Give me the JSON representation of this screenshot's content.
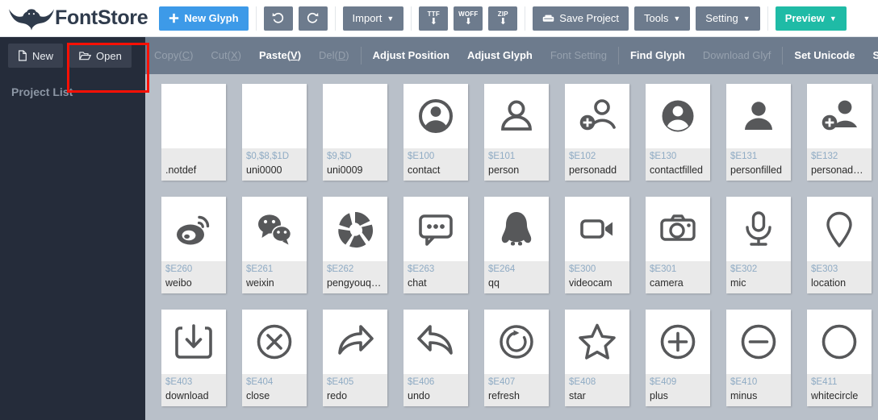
{
  "header": {
    "brand": "FontStore",
    "logo_icon": "bat-logo-icon",
    "new_glyph_label": "New Glyph",
    "new_glyph_icon": "plus-icon",
    "undo_icon": "undo-arrow-icon",
    "redo_icon": "redo-arrow-icon",
    "import_label": "Import",
    "ttf_label": "TTF",
    "woff_label": "WOFF",
    "zip_label": "ZIP",
    "download_arrow_icon": "download-arrow-icon",
    "save_project_label": "Save Project",
    "save_icon": "save-disk-icon",
    "tools_label": "Tools",
    "setting_label": "Setting",
    "preview_label": "Preview",
    "caret": "⌄",
    "accent_blue": "#3d9ae8",
    "accent_teal": "#1fbba6",
    "btn_grey": "#6d7b8d"
  },
  "menubar": {
    "new_label": "New",
    "new_icon": "file-icon",
    "open_label": "Open",
    "open_icon": "folder-open-icon",
    "items": [
      {
        "label": "Copy(C)",
        "text": "Copy(",
        "key": "C",
        "tail": ")",
        "enabled": false
      },
      {
        "label": "Cut(X)",
        "text": "Cut(",
        "key": "X",
        "tail": ")",
        "enabled": false
      },
      {
        "label": "Paste(V)",
        "text": "Paste(",
        "key": "V",
        "tail": ")",
        "enabled": true
      },
      {
        "label": "Del(D)",
        "text": "Del(",
        "key": "D",
        "tail": ")",
        "enabled": false
      }
    ],
    "items2": [
      {
        "label": "Adjust Position",
        "enabled": true
      },
      {
        "label": "Adjust Glyph",
        "enabled": true
      },
      {
        "label": "Font Setting",
        "enabled": false
      },
      {
        "label": "Find Glyph",
        "enabled": true
      },
      {
        "label": "Download Glyf",
        "enabled": false
      },
      {
        "label": "Set Unicode",
        "enabled": true
      },
      {
        "label": "Sync Font",
        "enabled": true
      }
    ]
  },
  "sidebar": {
    "title": "Project List"
  },
  "annotation": {
    "color": "#fc1005",
    "targets": "open-button"
  },
  "glyphs": [
    {
      "code": "",
      "name": ".notdef",
      "icon": "none"
    },
    {
      "code": "$0,$8,$1D",
      "name": "uni0000",
      "icon": "none"
    },
    {
      "code": "$9,$D",
      "name": "uni0009",
      "icon": "none"
    },
    {
      "code": "$E100",
      "name": "contact",
      "icon": "contact-outline-icon"
    },
    {
      "code": "$E101",
      "name": "person",
      "icon": "person-outline-icon"
    },
    {
      "code": "$E102",
      "name": "personadd",
      "icon": "person-add-icon"
    },
    {
      "code": "$E130",
      "name": "contactfilled",
      "icon": "contact-filled-icon"
    },
    {
      "code": "$E131",
      "name": "personfilled",
      "icon": "person-filled-icon"
    },
    {
      "code": "$E132",
      "name": "personaddfil...",
      "icon": "person-add-filled-icon"
    },
    {
      "code": "$E260",
      "name": "weibo",
      "icon": "weibo-icon"
    },
    {
      "code": "$E261",
      "name": "weixin",
      "icon": "weixin-icon"
    },
    {
      "code": "$E262",
      "name": "pengyouquan",
      "icon": "aperture-icon"
    },
    {
      "code": "$E263",
      "name": "chat",
      "icon": "chat-bubble-icon"
    },
    {
      "code": "$E264",
      "name": "qq",
      "icon": "qq-penguin-icon"
    },
    {
      "code": "$E300",
      "name": "videocam",
      "icon": "videocam-icon"
    },
    {
      "code": "$E301",
      "name": "camera",
      "icon": "camera-icon"
    },
    {
      "code": "$E302",
      "name": "mic",
      "icon": "mic-icon"
    },
    {
      "code": "$E303",
      "name": "location",
      "icon": "location-pin-icon"
    },
    {
      "code": "$E403",
      "name": "download",
      "icon": "download-box-icon"
    },
    {
      "code": "$E404",
      "name": "close",
      "icon": "close-circle-icon"
    },
    {
      "code": "$E405",
      "name": "redo",
      "icon": "redo-curve-icon"
    },
    {
      "code": "$E406",
      "name": "undo",
      "icon": "undo-curve-icon"
    },
    {
      "code": "$E407",
      "name": "refresh",
      "icon": "refresh-circle-icon"
    },
    {
      "code": "$E408",
      "name": "star",
      "icon": "star-outline-icon"
    },
    {
      "code": "$E409",
      "name": "plus",
      "icon": "plus-circle-icon"
    },
    {
      "code": "$E410",
      "name": "minus",
      "icon": "minus-circle-icon"
    },
    {
      "code": "$E411",
      "name": "whitecircle",
      "icon": "circle-outline-icon"
    }
  ]
}
